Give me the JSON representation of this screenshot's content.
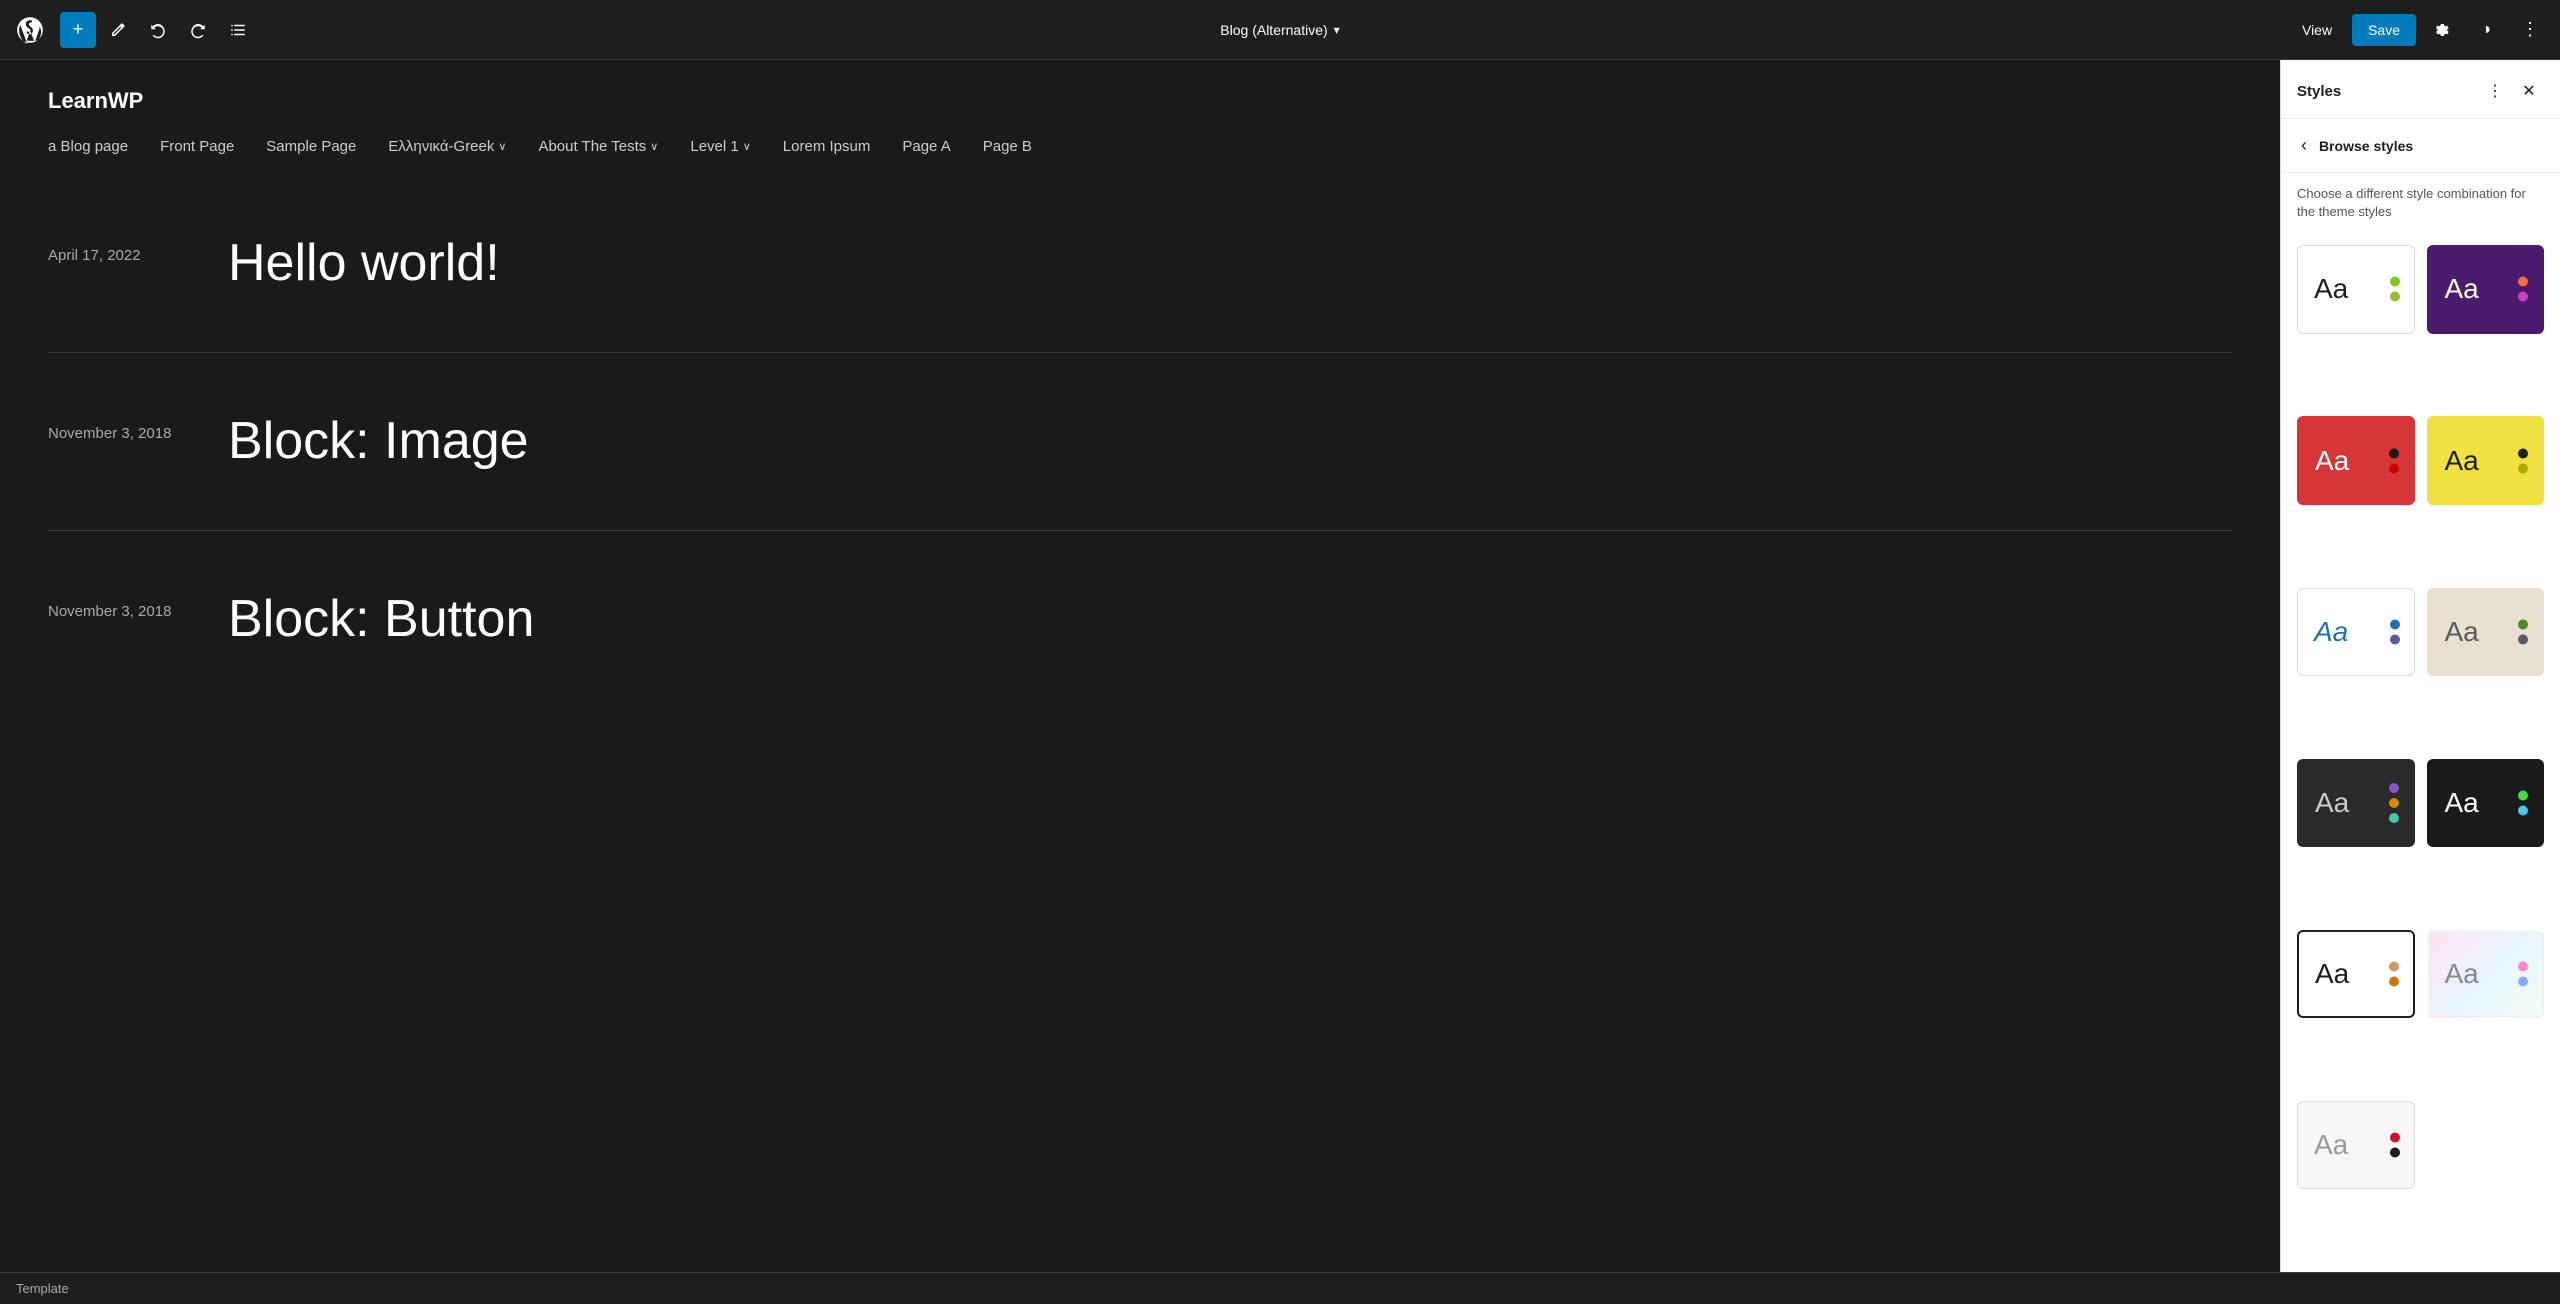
{
  "toolbar": {
    "add_label": "+",
    "pencil_label": "✏",
    "undo_label": "↩",
    "redo_label": "↪",
    "list_label": "≡",
    "page_title": "Blog (Alternative)",
    "view_label": "View",
    "save_label": "Save"
  },
  "site": {
    "title": "LearnWP",
    "nav_items": [
      {
        "label": "a Blog page",
        "has_dropdown": false
      },
      {
        "label": "Front Page",
        "has_dropdown": false
      },
      {
        "label": "Sample Page",
        "has_dropdown": false
      },
      {
        "label": "Ελληνικά-Greek",
        "has_dropdown": true
      },
      {
        "label": "About The Tests",
        "has_dropdown": true
      },
      {
        "label": "Level 1",
        "has_dropdown": true
      },
      {
        "label": "Lorem Ipsum",
        "has_dropdown": false
      },
      {
        "label": "Page A",
        "has_dropdown": false
      },
      {
        "label": "Page B",
        "has_dropdown": false
      }
    ]
  },
  "posts": [
    {
      "date": "April 17, 2022",
      "title": "Hello world!"
    },
    {
      "date": "November 3, 2018",
      "title": "Block: Image"
    },
    {
      "date": "November 3, 2018",
      "title": "Block: Button"
    }
  ],
  "footer": {
    "status": "Template"
  },
  "styles_panel": {
    "title": "Styles",
    "browse_title": "Browse styles",
    "description": "Choose a different style combination for the theme styles",
    "cards": [
      {
        "id": "default",
        "class": "card-default",
        "aa_color": "#1e1e1e",
        "dots": [
          "#7dc821",
          "#9abf2c"
        ],
        "active": false
      },
      {
        "id": "purple",
        "class": "card-purple",
        "aa_color": "#fff",
        "dots": [
          "#ff6b45",
          "#cc44bb"
        ],
        "active": false
      },
      {
        "id": "red",
        "class": "card-red",
        "aa_color": "#fff",
        "dots": [
          "#1a1a1a",
          "#cc0000"
        ],
        "active": false
      },
      {
        "id": "yellow",
        "class": "card-yellow",
        "aa_color": "#1e1e1e",
        "dots": [
          "#1e1e1e",
          "#aaaa00"
        ],
        "active": false
      },
      {
        "id": "blue-outline",
        "class": "card-blue-outline",
        "aa_color": "#2271b1",
        "dots": [
          "#2271b1",
          "#5a5aa0"
        ],
        "active": false
      },
      {
        "id": "beige",
        "class": "card-beige",
        "aa_color": "#5a5a5a",
        "dots": [
          "#4a8a20",
          "#5a5a5a"
        ],
        "active": false
      },
      {
        "id": "dark-multi",
        "class": "card-dark-multi",
        "aa_color": "#ccc",
        "dots": [
          "#8855cc",
          "#dd8800",
          "#44ccaa"
        ],
        "active": false
      },
      {
        "id": "black",
        "class": "card-black",
        "aa_color": "#fff",
        "dots": [
          "#44dd44",
          "#44ccee"
        ],
        "active": false
      },
      {
        "id": "bordered",
        "class": "card-bordered",
        "aa_color": "#1e1e1e",
        "dots": [
          "#cc9966",
          "#cc7700"
        ],
        "active": true
      },
      {
        "id": "gradient",
        "class": "card-gradient",
        "aa_color": "#555",
        "dots": [
          "#ff88cc",
          "#aaddff"
        ],
        "active": false
      },
      {
        "id": "light-red",
        "class": "card-light-red",
        "aa_color": "#888",
        "dots": [
          "#cc1133",
          "#1a1a1a"
        ],
        "active": false
      }
    ]
  }
}
